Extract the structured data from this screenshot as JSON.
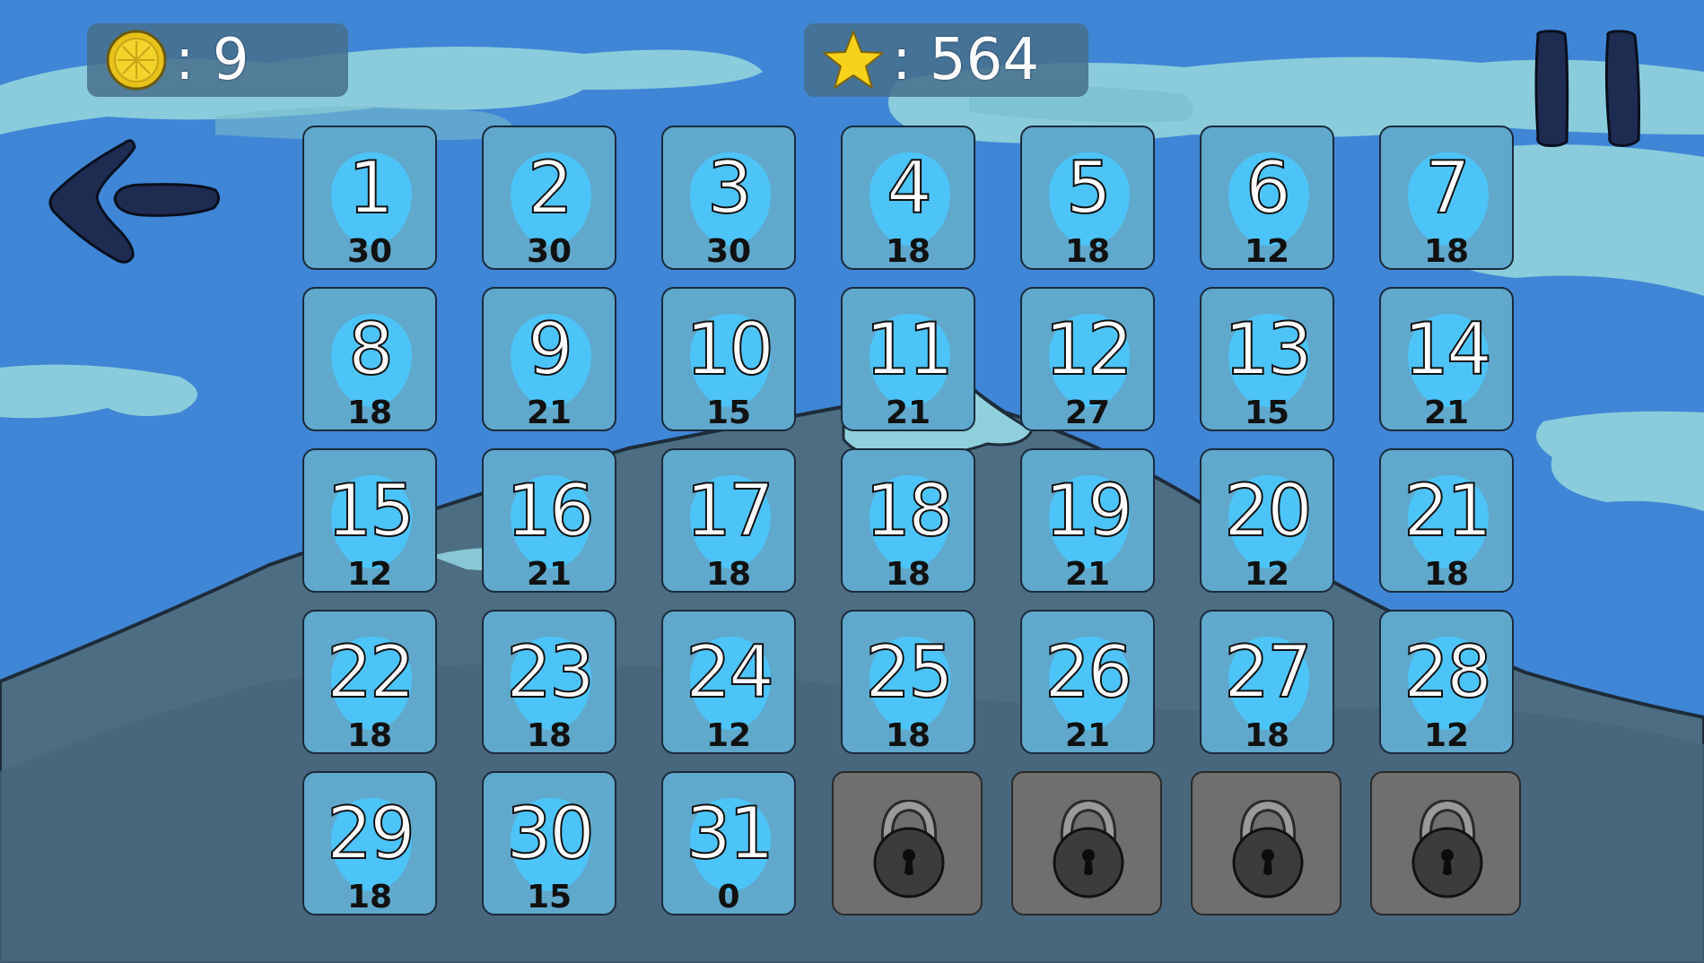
{
  "hud": {
    "coins": {
      "label": ": 9",
      "icon": "coin-icon"
    },
    "stars": {
      "label": ": 564",
      "icon": "star-icon"
    }
  },
  "controls": {
    "pause_icon": "pause-icon",
    "back_icon": "back-arrow-icon"
  },
  "levels": [
    {
      "number": "1",
      "stars": "30"
    },
    {
      "number": "2",
      "stars": "30"
    },
    {
      "number": "3",
      "stars": "30"
    },
    {
      "number": "4",
      "stars": "18"
    },
    {
      "number": "5",
      "stars": "18"
    },
    {
      "number": "6",
      "stars": "12"
    },
    {
      "number": "7",
      "stars": "18"
    },
    {
      "number": "8",
      "stars": "18"
    },
    {
      "number": "9",
      "stars": "21"
    },
    {
      "number": "10",
      "stars": "15"
    },
    {
      "number": "11",
      "stars": "21"
    },
    {
      "number": "12",
      "stars": "27"
    },
    {
      "number": "13",
      "stars": "15"
    },
    {
      "number": "14",
      "stars": "21"
    },
    {
      "number": "15",
      "stars": "12"
    },
    {
      "number": "16",
      "stars": "21"
    },
    {
      "number": "17",
      "stars": "18"
    },
    {
      "number": "18",
      "stars": "18"
    },
    {
      "number": "19",
      "stars": "21"
    },
    {
      "number": "20",
      "stars": "12"
    },
    {
      "number": "21",
      "stars": "18"
    },
    {
      "number": "22",
      "stars": "18"
    },
    {
      "number": "23",
      "stars": "18"
    },
    {
      "number": "24",
      "stars": "12"
    },
    {
      "number": "25",
      "stars": "18"
    },
    {
      "number": "26",
      "stars": "21"
    },
    {
      "number": "27",
      "stars": "18"
    },
    {
      "number": "28",
      "stars": "12"
    },
    {
      "number": "29",
      "stars": "18"
    },
    {
      "number": "30",
      "stars": "15"
    },
    {
      "number": "31",
      "stars": "0"
    }
  ],
  "locked_levels": [
    {
      "icon": "padlock-icon"
    },
    {
      "icon": "padlock-icon"
    },
    {
      "icon": "padlock-icon"
    },
    {
      "icon": "padlock-icon"
    }
  ],
  "colors": {
    "sky": "#3f86d6",
    "tile": "#60a8cc",
    "tile_blob": "#4dc4f7",
    "locked_tile": "#6f6f6f",
    "icon_dark": "#1e2c52"
  }
}
